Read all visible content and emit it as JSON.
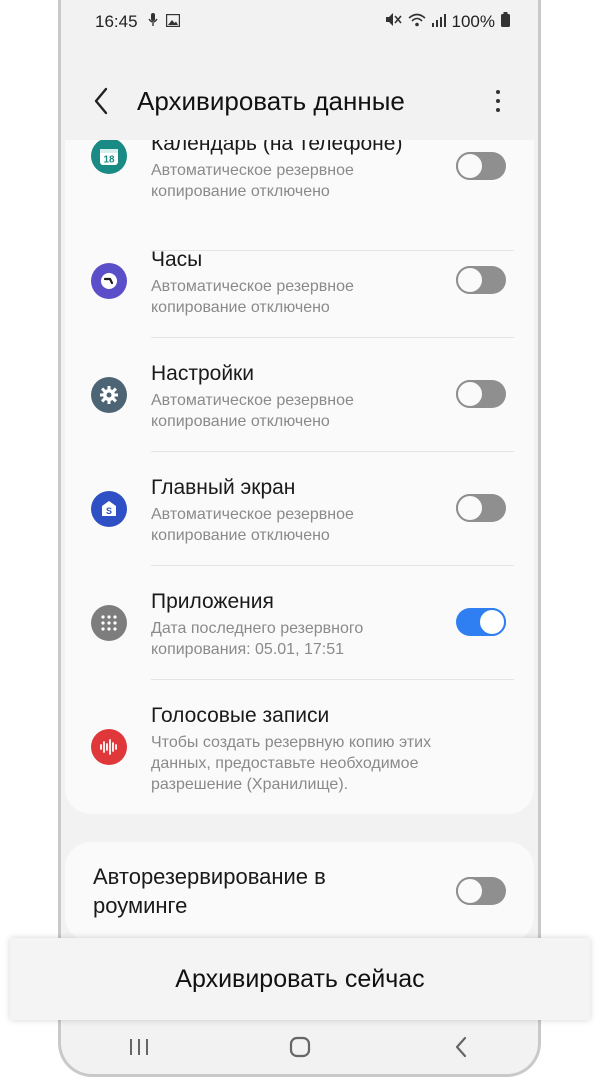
{
  "status_bar": {
    "time": "16:45",
    "battery": "100%"
  },
  "app_bar": {
    "title": "Архивировать данные"
  },
  "items": [
    {
      "label": "Календарь (на телефоне)",
      "sub": "Автоматическое резервное копирование отключено",
      "toggle": "off",
      "icon": "calendar-icon",
      "color": "#1a8a84"
    },
    {
      "label": "Часы",
      "sub": "Автоматическое резервное копирование отключено",
      "toggle": "off",
      "icon": "clock-icon",
      "color": "#5a4fc8"
    },
    {
      "label": "Настройки",
      "sub": "Автоматическое резервное копирование отключено",
      "toggle": "off",
      "icon": "gear-icon",
      "color": "#4d6474"
    },
    {
      "label": "Главный экран",
      "sub": "Автоматическое резервное копирование отключено",
      "toggle": "off",
      "icon": "home-screen-icon",
      "color": "#2f4fc4"
    },
    {
      "label": "Приложения",
      "sub": "Дата последнего резервного копирования: 05.01, 17:51",
      "toggle": "on",
      "icon": "apps-grid-icon",
      "color": "#7d7d7d"
    },
    {
      "label": "Голосовые записи",
      "sub": "Чтобы создать резервную копию этих данных, предоставьте необходимое разрешение (Хранилище).",
      "toggle": "none",
      "icon": "voice-recorder-icon",
      "color": "#e0383a"
    }
  ],
  "roaming": {
    "label": "Авторезервирование в роуминге",
    "toggle": "off"
  },
  "action": {
    "label": "Архивировать сейчас"
  }
}
